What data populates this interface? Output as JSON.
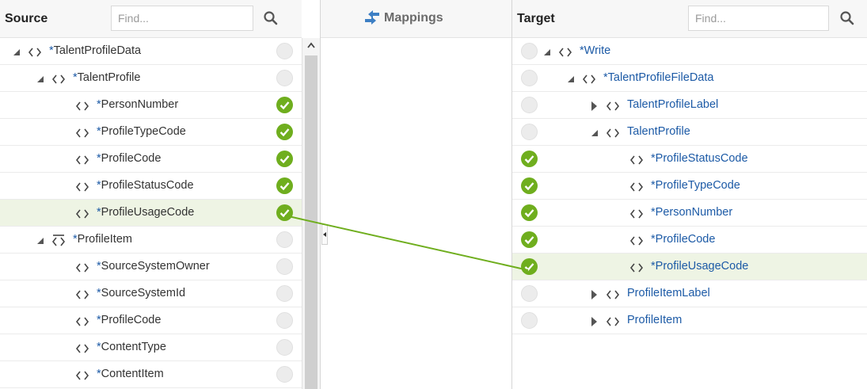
{
  "source": {
    "title": "Source",
    "find_placeholder": "Find...",
    "rows": [
      {
        "label": "TalentProfileData",
        "required": true,
        "status": "empty"
      },
      {
        "label": "TalentProfile",
        "required": true,
        "status": "empty"
      },
      {
        "label": "PersonNumber",
        "required": true,
        "status": "mapped"
      },
      {
        "label": "ProfileTypeCode",
        "required": true,
        "status": "mapped"
      },
      {
        "label": "ProfileCode",
        "required": true,
        "status": "mapped"
      },
      {
        "label": "ProfileStatusCode",
        "required": true,
        "status": "mapped"
      },
      {
        "label": "ProfileUsageCode",
        "required": true,
        "status": "mapped",
        "selected": true
      },
      {
        "label": "ProfileItem",
        "required": true,
        "status": "empty"
      },
      {
        "label": "SourceSystemOwner",
        "required": true,
        "status": "empty"
      },
      {
        "label": "SourceSystemId",
        "required": true,
        "status": "empty"
      },
      {
        "label": "ProfileCode",
        "required": true,
        "status": "empty"
      },
      {
        "label": "ContentType",
        "required": true,
        "status": "empty"
      },
      {
        "label": "ContentItem",
        "required": true,
        "status": "empty"
      }
    ]
  },
  "mappings": {
    "title": "Mappings"
  },
  "target": {
    "title": "Target",
    "find_placeholder": "Find...",
    "rows": [
      {
        "label": "Write",
        "required": true,
        "status": "empty"
      },
      {
        "label": "TalentProfileFileData",
        "required": true,
        "status": "empty"
      },
      {
        "label": "TalentProfileLabel",
        "required": false,
        "status": "empty"
      },
      {
        "label": "TalentProfile",
        "required": false,
        "status": "empty"
      },
      {
        "label": "ProfileStatusCode",
        "required": true,
        "status": "mapped"
      },
      {
        "label": "ProfileTypeCode",
        "required": true,
        "status": "mapped"
      },
      {
        "label": "PersonNumber",
        "required": true,
        "status": "mapped"
      },
      {
        "label": "ProfileCode",
        "required": true,
        "status": "mapped"
      },
      {
        "label": "ProfileUsageCode",
        "required": true,
        "status": "mapped",
        "selected": true
      },
      {
        "label": "ProfileItemLabel",
        "required": false,
        "status": "empty"
      },
      {
        "label": "ProfileItem",
        "required": false,
        "status": "empty"
      }
    ]
  },
  "colors": {
    "mapped": "#6fae1e",
    "link": "#1c5aa6",
    "selected_row": "#eef4e4"
  },
  "icons": {
    "search": "search-icon",
    "element": "element-tag-icon",
    "mapped": "check-circle-icon",
    "unmapped": "empty-circle-icon"
  }
}
